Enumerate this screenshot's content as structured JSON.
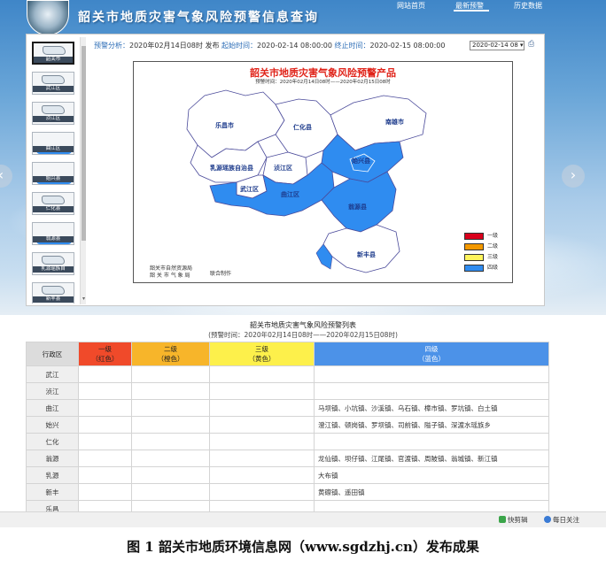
{
  "header": {
    "site_title": "韶关市地质灾害气象风险预警信息查询",
    "nav": [
      "网站首页",
      "最新预警",
      "历史数据"
    ]
  },
  "thumbnails": [
    "韶关市",
    "武江区",
    "浈江区",
    "曲江区",
    "始兴县",
    "仁化县",
    "翁源县",
    "乳源瑶族自",
    "新丰县"
  ],
  "info": {
    "analysis_key": "预警分析：",
    "analysis_value": "2020年02月14日08时 发布",
    "start_key": "起始时间：",
    "start_value": "2020-02-14 08:00:00",
    "end_key": "终止时间：",
    "end_value": "2020-02-15 08:00:00"
  },
  "date_select": "2020-02-14 08 ▾",
  "product": {
    "title": "韶关市地质灾害气象风险预警产品",
    "time": "预警时间：2020年02月14日08时——2020年02月15日08时",
    "credit_line1": "韶关市自然资源局",
    "credit_line2": "韶 关 市 气 象 局",
    "credit_suffix": "联合制作",
    "counties": {
      "lechang": "乐昌市",
      "renhua": "仁化县",
      "nanxiong": "南雄市",
      "ruyuan": "乳源瑶族自治县",
      "zhenjiang": "浈江区",
      "shixing": "始兴县",
      "wujiang": "武江区",
      "qujiang": "曲江区",
      "wengyuan": "翁源县",
      "xinfeng": "新丰县"
    },
    "legend": [
      {
        "label": "一级",
        "color": "#d9001b"
      },
      {
        "label": "二级",
        "color": "#f39800"
      },
      {
        "label": "三级",
        "color": "#fff45c"
      },
      {
        "label": "四级",
        "color": "#2f8cf0"
      }
    ]
  },
  "list": {
    "title": "韶关市地质灾害气象风险预警列表",
    "time": "(预警时间：2020年02月14日08时——2020年02月15日08时)",
    "headers": {
      "area": "行政区",
      "l1": "一级",
      "l1_sub": "（红色）",
      "l2": "二级",
      "l2_sub": "（橙色）",
      "l3": "三级",
      "l3_sub": "（黄色）",
      "l4": "四级",
      "l4_sub": "（蓝色）"
    },
    "rows": [
      {
        "area": "武江",
        "towns": ""
      },
      {
        "area": "浈江",
        "towns": ""
      },
      {
        "area": "曲江",
        "towns": "马坝镇、小坑镇、沙溪镇、乌石镇、樟市镇、罗坑镇、白土镇"
      },
      {
        "area": "始兴",
        "towns": "澄江镇、顿岗镇、罗坝镇、司前镇、隘子镇、深渡水瑶族乡"
      },
      {
        "area": "仁化",
        "towns": ""
      },
      {
        "area": "翁源",
        "towns": "龙仙镇、坝仔镇、江尾镇、官渡镇、周陂镇、翁城镇、新江镇"
      },
      {
        "area": "乳源",
        "towns": "大布镇"
      },
      {
        "area": "新丰",
        "towns": "黄磜镇、遥田镇"
      },
      {
        "area": "乐昌",
        "towns": ""
      }
    ]
  },
  "statusbar": {
    "quick": "快剪辑",
    "daily": "每日关注"
  },
  "caption": "图 1 韶关市地质环境信息网（www.sgdzhj.cn）发布成果"
}
